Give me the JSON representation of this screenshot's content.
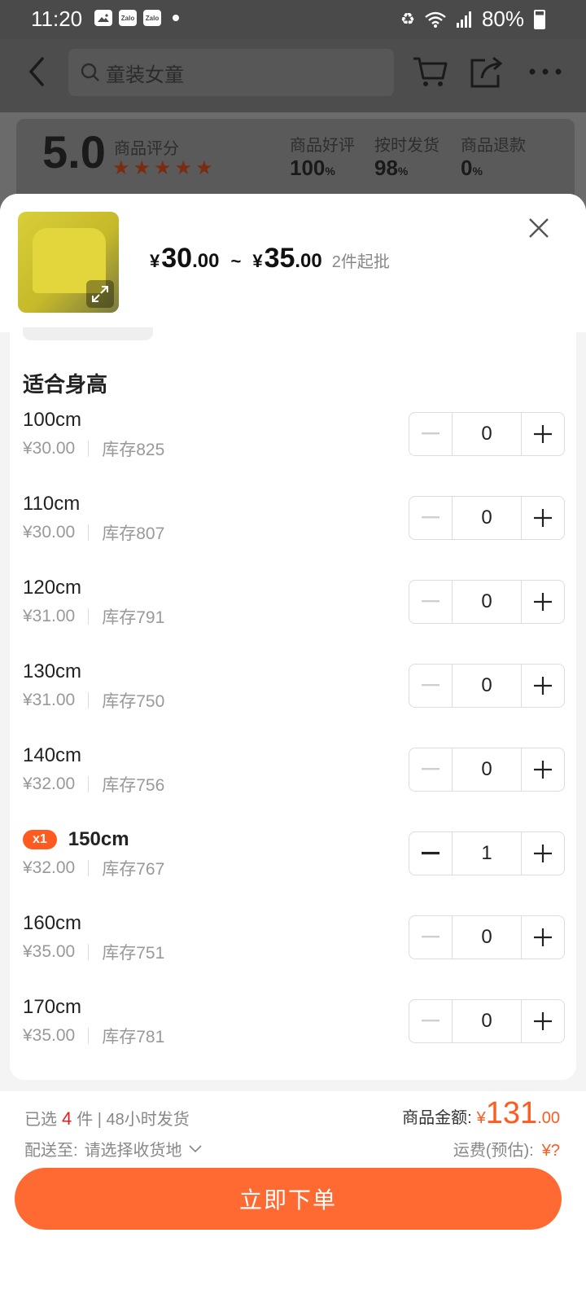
{
  "status_bar": {
    "time": "11:20",
    "app_icons": [
      "Zalo",
      "Zalo"
    ],
    "battery": "80%"
  },
  "header": {
    "search_placeholder": "童装女童"
  },
  "rating": {
    "score": "5.0",
    "label": "商品评分",
    "stars": 5,
    "stats": [
      {
        "label": "商品好评",
        "value": "100",
        "unit": "%"
      },
      {
        "label": "按时发货",
        "value": "98",
        "unit": "%"
      },
      {
        "label": "商品退款",
        "value": "0",
        "unit": "%"
      }
    ]
  },
  "product": {
    "currency": "¥",
    "price_min_int": "30",
    "price_min_dec": ".00",
    "tilde": "~",
    "price_max_int": "35",
    "price_max_dec": ".00",
    "moq": "2件起批"
  },
  "section_title": "适合身高",
  "sizes": [
    {
      "label": "100cm",
      "price": "¥30.00",
      "stock": "库存825",
      "qty": "0"
    },
    {
      "label": "110cm",
      "price": "¥30.00",
      "stock": "库存807",
      "qty": "0"
    },
    {
      "label": "120cm",
      "price": "¥31.00",
      "stock": "库存791",
      "qty": "0"
    },
    {
      "label": "130cm",
      "price": "¥31.00",
      "stock": "库存750",
      "qty": "0"
    },
    {
      "label": "140cm",
      "price": "¥32.00",
      "stock": "库存756",
      "qty": "0"
    },
    {
      "label": "150cm",
      "price": "¥32.00",
      "stock": "库存767",
      "qty": "1",
      "badge": "x1"
    },
    {
      "label": "160cm",
      "price": "¥35.00",
      "stock": "库存751",
      "qty": "0"
    },
    {
      "label": "170cm",
      "price": "¥35.00",
      "stock": "库存781",
      "qty": "0"
    }
  ],
  "footer": {
    "selected_prefix": "已选",
    "selected_count": "4",
    "selected_suffix": "件 | 48小时发货",
    "ship_to_label": "配送至:",
    "ship_to_value": "请选择收货地",
    "amount_label": "商品金额:",
    "amount_currency": "¥",
    "amount_int": "131",
    "amount_dec": ".00",
    "shipping_label": "运费(预估):",
    "shipping_value": "¥?",
    "order_button": "立即下单"
  },
  "colors": {
    "accent": "#ff6a33",
    "badge": "#ff5a1f",
    "count_red": "#e02020"
  }
}
